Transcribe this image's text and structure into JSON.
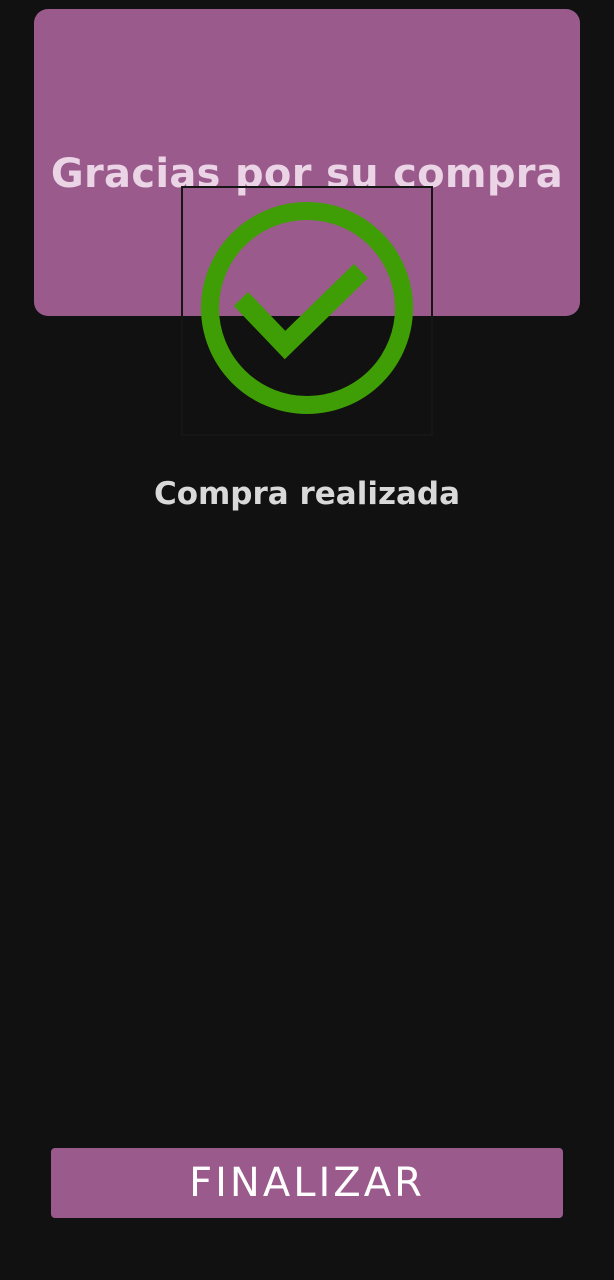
{
  "header": {
    "title": "Gracias por su compra",
    "background_color": "#9b5a8c",
    "title_color": "#ead4e6"
  },
  "status": {
    "icon": "check-circle-icon",
    "icon_color": "#3f9e05",
    "message": "Compra realizada"
  },
  "actions": {
    "finish_label": "FINALIZAR",
    "button_color": "#9b5a8c"
  },
  "theme": {
    "background": "#111111"
  }
}
